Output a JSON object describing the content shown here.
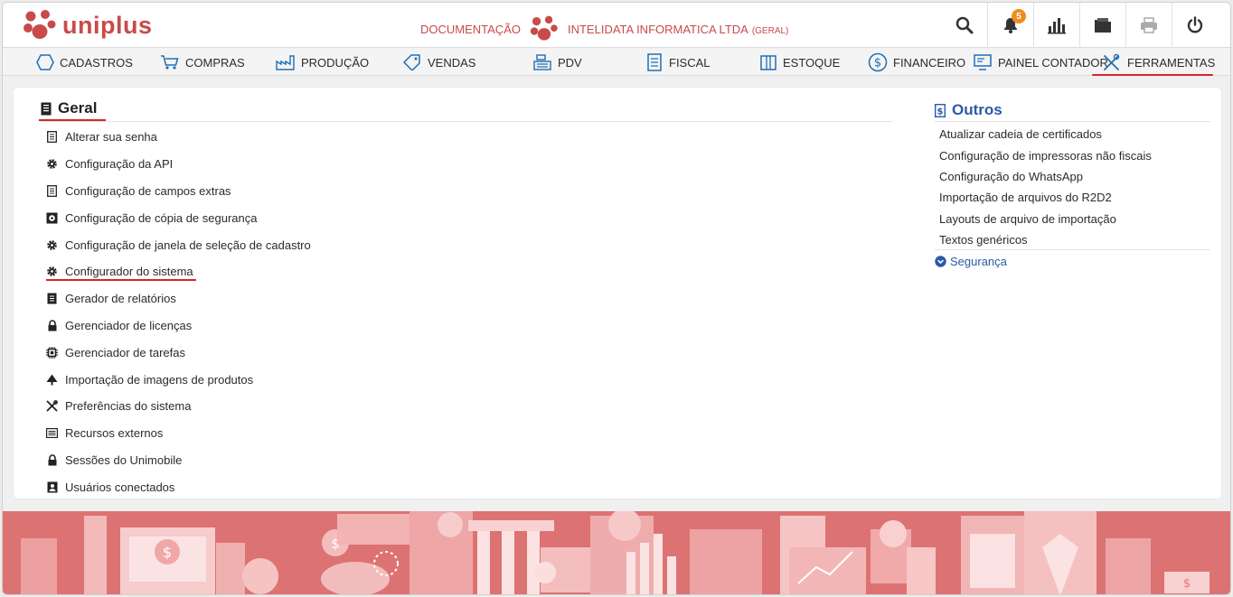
{
  "header": {
    "logo_text": "uniplus",
    "documentation_label": "DOCUMENTAÇÃO",
    "company_name": "INTELIDATA INFORMATICA LTDA",
    "company_scope": "(GERAL)",
    "notifications_count": "5",
    "brand_color": "#c94a4a"
  },
  "nav": {
    "items": [
      {
        "label": "CADASTROS",
        "icon": "hexagon-icon"
      },
      {
        "label": "COMPRAS",
        "icon": "cart-icon"
      },
      {
        "label": "PRODUÇÃO",
        "icon": "factory-icon"
      },
      {
        "label": "VENDAS",
        "icon": "tag-icon"
      },
      {
        "label": "PDV",
        "icon": "cash-register-icon"
      },
      {
        "label": "FISCAL",
        "icon": "document-icon"
      },
      {
        "label": "ESTOQUE",
        "icon": "box-icon"
      },
      {
        "label": "FINANCEIRO",
        "icon": "dollar-circle-icon"
      },
      {
        "label": "PAINEL CONTADOR",
        "icon": "monitor-icon"
      },
      {
        "label": "FERRAMENTAS",
        "icon": "tools-icon"
      }
    ],
    "active": "FERRAMENTAS",
    "accent_color": "#d9232d"
  },
  "geral": {
    "title": "Geral",
    "items": [
      {
        "label": "Alterar sua senha",
        "icon": "form-icon"
      },
      {
        "label": "Configuração da API",
        "icon": "gear-icon"
      },
      {
        "label": "Configuração de campos extras",
        "icon": "form-icon"
      },
      {
        "label": "Configuração de cópia de segurança",
        "icon": "disk-icon"
      },
      {
        "label": "Configuração de janela de seleção de cadastro",
        "icon": "gear-icon"
      },
      {
        "label": "Configurador do sistema",
        "icon": "gear-icon"
      },
      {
        "label": "Gerador de relatórios",
        "icon": "report-icon"
      },
      {
        "label": "Gerenciador de licenças",
        "icon": "lock-icon"
      },
      {
        "label": "Gerenciador de tarefas",
        "icon": "chip-icon"
      },
      {
        "label": "Importação de imagens de produtos",
        "icon": "tree-icon"
      },
      {
        "label": "Preferências do sistema",
        "icon": "wrench-icon"
      },
      {
        "label": "Recursos externos",
        "icon": "list-icon"
      },
      {
        "label": "Sessões do Unimobile",
        "icon": "lock-icon"
      },
      {
        "label": "Usuários conectados",
        "icon": "user-card-icon"
      }
    ]
  },
  "outros": {
    "title": "Outros",
    "items": [
      "Atualizar cadeia de certificados",
      "Configuração de impressoras não fiscais",
      "Configuração do WhatsApp",
      "Importação de arquivos do R2D2",
      "Layouts de arquivo de importação",
      "Textos genéricos"
    ],
    "seguranca_label": "Segurança",
    "accent_color": "#2a5aa6"
  }
}
